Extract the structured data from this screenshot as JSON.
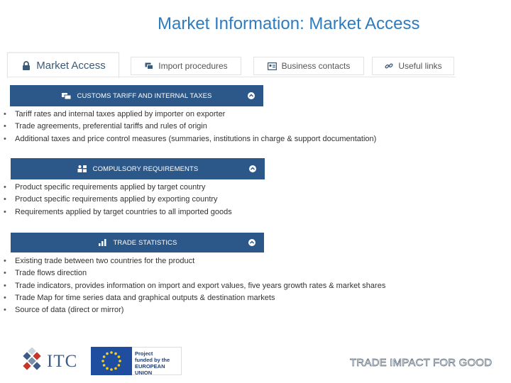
{
  "title": "Market Information: Market Access",
  "tabs": [
    {
      "label": "Market Access",
      "icon": "lock-icon",
      "active": true
    },
    {
      "label": "Import procedures",
      "icon": "documents-icon",
      "active": false
    },
    {
      "label": "Business contacts",
      "icon": "contact-card-icon",
      "active": false
    },
    {
      "label": "Useful links",
      "icon": "link-icon",
      "active": false
    }
  ],
  "sections": [
    {
      "header": "CUSTOMS TARIFF AND INTERNAL TAXES",
      "icon": "tariff-icon",
      "items": [
        "Tariff rates and internal taxes applied by importer on exporter",
        "Trade agreements, preferential tariffs and rules of origin",
        "Additional taxes and price control measures (summaries, institutions in charge & support documentation)"
      ]
    },
    {
      "header": "COMPULSORY REQUIREMENTS",
      "icon": "requirements-icon",
      "items": [
        "Product specific requirements applied by target country",
        "Product specific requirements applied by exporting country",
        "Requirements applied by target countries to all imported goods"
      ]
    },
    {
      "header": "TRADE STATISTICS",
      "icon": "bar-chart-icon",
      "items": [
        "Existing trade between two countries for the product",
        "Trade flows direction",
        "Trade indicators, provides information on import and export values, five years growth rates & market shares",
        "Trade Map for time series data and graphical outputs & destination markets",
        "Source of data (direct or mirror)"
      ]
    }
  ],
  "footer": {
    "itc_logo_text": "ITC",
    "eu_text_line1": "Project",
    "eu_text_line2": "funded by the",
    "eu_text_line3": "EUROPEAN UNION",
    "tagline": "TRADE IMPACT FOR GOOD"
  },
  "colors": {
    "title": "#2e7bbf",
    "section_bar": "#2c5889",
    "tab_text": "#555555"
  }
}
